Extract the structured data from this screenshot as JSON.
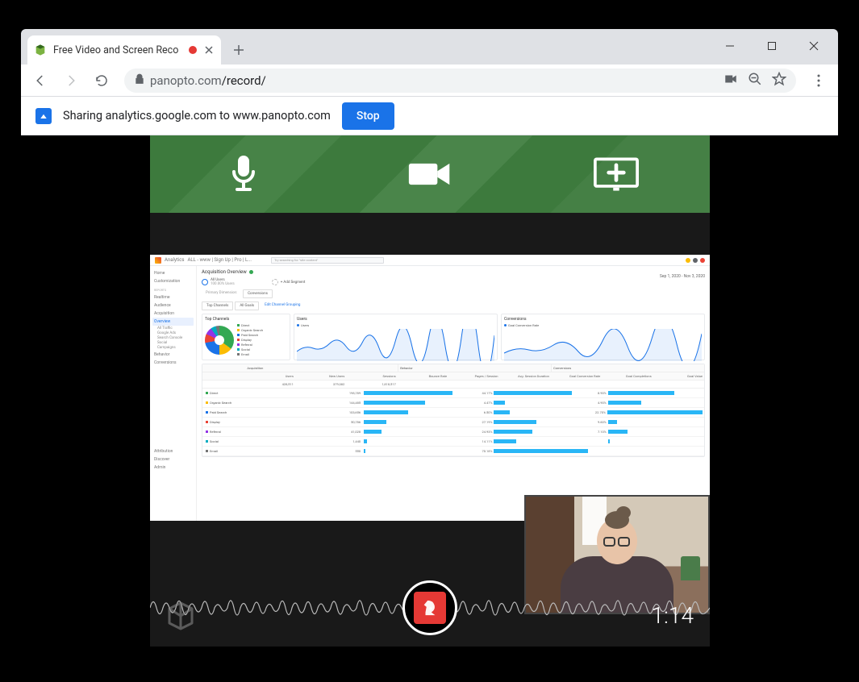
{
  "browser": {
    "tab_title": "Free Video and Screen Reco",
    "url_host": "panopto.com",
    "url_path": "/record/",
    "info_text": "Sharing analytics.google.com to www.panopto.com",
    "stop_label": "Stop"
  },
  "recorder": {
    "timer": "1:14"
  },
  "analytics": {
    "app_name": "Analytics",
    "account": "ALL - www | Sign Up | Pro | L...",
    "search_placeholder": "Try searching for \"site content\"",
    "date_range": "Sep 1, 2020 - Nov 3, 2020",
    "page_title": "Acquisition Overview",
    "sidebar": {
      "home": "Home",
      "customization": "Customization",
      "reports": "REPORTS",
      "realtime": "Realtime",
      "audience": "Audience",
      "acquisition": "Acquisition",
      "overview": "Overview",
      "all_traffic": "All Traffic",
      "google_ads": "Google Ads",
      "search_console": "Search Console",
      "social": "Social",
      "campaigns": "Campaigns",
      "behavior": "Behavior",
      "conversions": "Conversions",
      "attribution": "Attribution",
      "discover": "Discover",
      "admin": "Admin"
    },
    "segments": {
      "all_users": "All Users",
      "all_users_pct": "100.00% Users",
      "add_segment": "+ Add Segment"
    },
    "tabs": {
      "top_channels": "Top Channels",
      "primary": "Primary Dimension:",
      "conversions": "Conversions",
      "all_goals": "All Goals",
      "edit": "Edit Channel Grouping"
    },
    "pie_title": "Top Channels",
    "pie_legend": [
      "Direct",
      "Organic Search",
      "Paid Search",
      "Display",
      "Referral",
      "Social",
      "Email"
    ],
    "users_title": "Users",
    "users_legend": "Users",
    "conversions_title": "Conversions",
    "conv_legend": "Goal Conversion Rate",
    "table_headers": {
      "acquisition": "Acquisition",
      "behavior": "Behavior",
      "conversions_h": "Conversions",
      "users": "Users",
      "new_users": "New Users",
      "sessions": "Sessions",
      "bounce_rate": "Bounce Rate",
      "pages_session": "Pages / Session",
      "avg_duration": "Avg. Session Duration",
      "goal_rate": "Goal Conversion Rate",
      "goal_completions": "Goal Completions",
      "goal_value": "Goal Value"
    },
    "totals": {
      "users": "428,511",
      "new_users": "379,382",
      "sessions": "1,818,517"
    },
    "rows": [
      {
        "label": "Direct",
        "color": "#34a853",
        "users": "198,789",
        "acq_pct": 80,
        "bounce": "44.17%",
        "beh_pct": 70,
        "conv": "8.90%",
        "conv_pct": 60
      },
      {
        "label": "Organic Search",
        "color": "#fbbc04",
        "users": "144,485",
        "acq_pct": 55,
        "bounce": "4.47%",
        "beh_pct": 10,
        "conv": "4.90%",
        "conv_pct": 30
      },
      {
        "label": "Paid Search",
        "color": "#1a73e8",
        "users": "103,656",
        "acq_pct": 40,
        "bounce": "6.50%",
        "beh_pct": 14,
        "conv": "22.70%",
        "conv_pct": 90
      },
      {
        "label": "Display",
        "color": "#ea4335",
        "users": "50,786",
        "acq_pct": 20,
        "bounce": "27.19%",
        "beh_pct": 38,
        "conv": "9.60%",
        "conv_pct": 8
      },
      {
        "label": "Referral",
        "color": "#9334e6",
        "users": "41,028",
        "acq_pct": 16,
        "bounce": "24.93%",
        "beh_pct": 35,
        "conv": "7.10%",
        "conv_pct": 18
      },
      {
        "label": "Social",
        "color": "#00acc1",
        "users": "1,440",
        "acq_pct": 3,
        "bounce": "14.11%",
        "beh_pct": 20,
        "conv": "",
        "conv_pct": 2
      },
      {
        "label": "Email",
        "color": "#757575",
        "users": "550",
        "acq_pct": 1,
        "bounce": "70.18%",
        "beh_pct": 85,
        "conv": "",
        "conv_pct": 0
      }
    ]
  },
  "colors": {
    "accent": "#1a73e8",
    "rec_red": "#e53935",
    "green_bar": "#3f7a3f"
  }
}
